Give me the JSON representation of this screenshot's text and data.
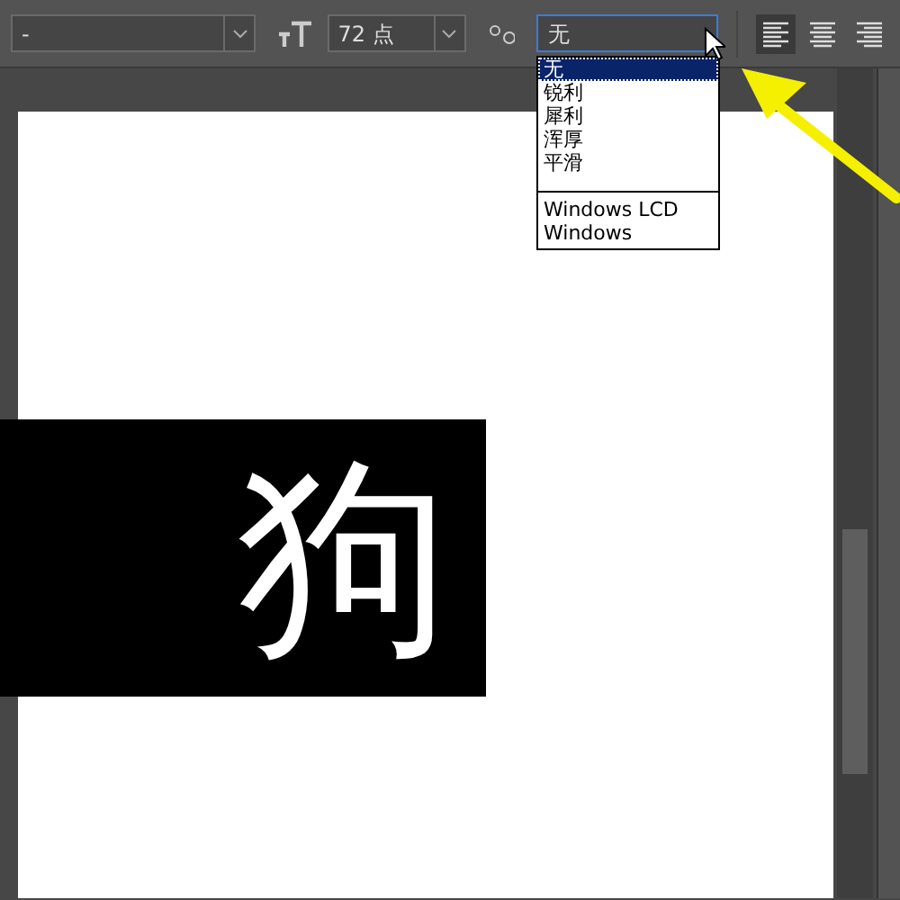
{
  "toolbar": {
    "font_style": "-",
    "size": "72 点",
    "antialias": "无",
    "align_buttons": [
      {
        "kind": "left",
        "selected": true
      },
      {
        "kind": "center",
        "selected": false
      },
      {
        "kind": "right",
        "selected": false
      }
    ]
  },
  "antialias_menu": {
    "groups": [
      {
        "items": [
          {
            "label": "无",
            "selected": true
          },
          {
            "label": "锐利",
            "selected": false
          },
          {
            "label": "犀利",
            "selected": false
          },
          {
            "label": "浑厚",
            "selected": false
          },
          {
            "label": "平滑",
            "selected": false
          }
        ]
      },
      {
        "items": [
          {
            "label": "Windows LCD",
            "selected": false
          },
          {
            "label": "Windows",
            "selected": false
          }
        ]
      }
    ]
  },
  "canvas": {
    "text": "狗"
  }
}
